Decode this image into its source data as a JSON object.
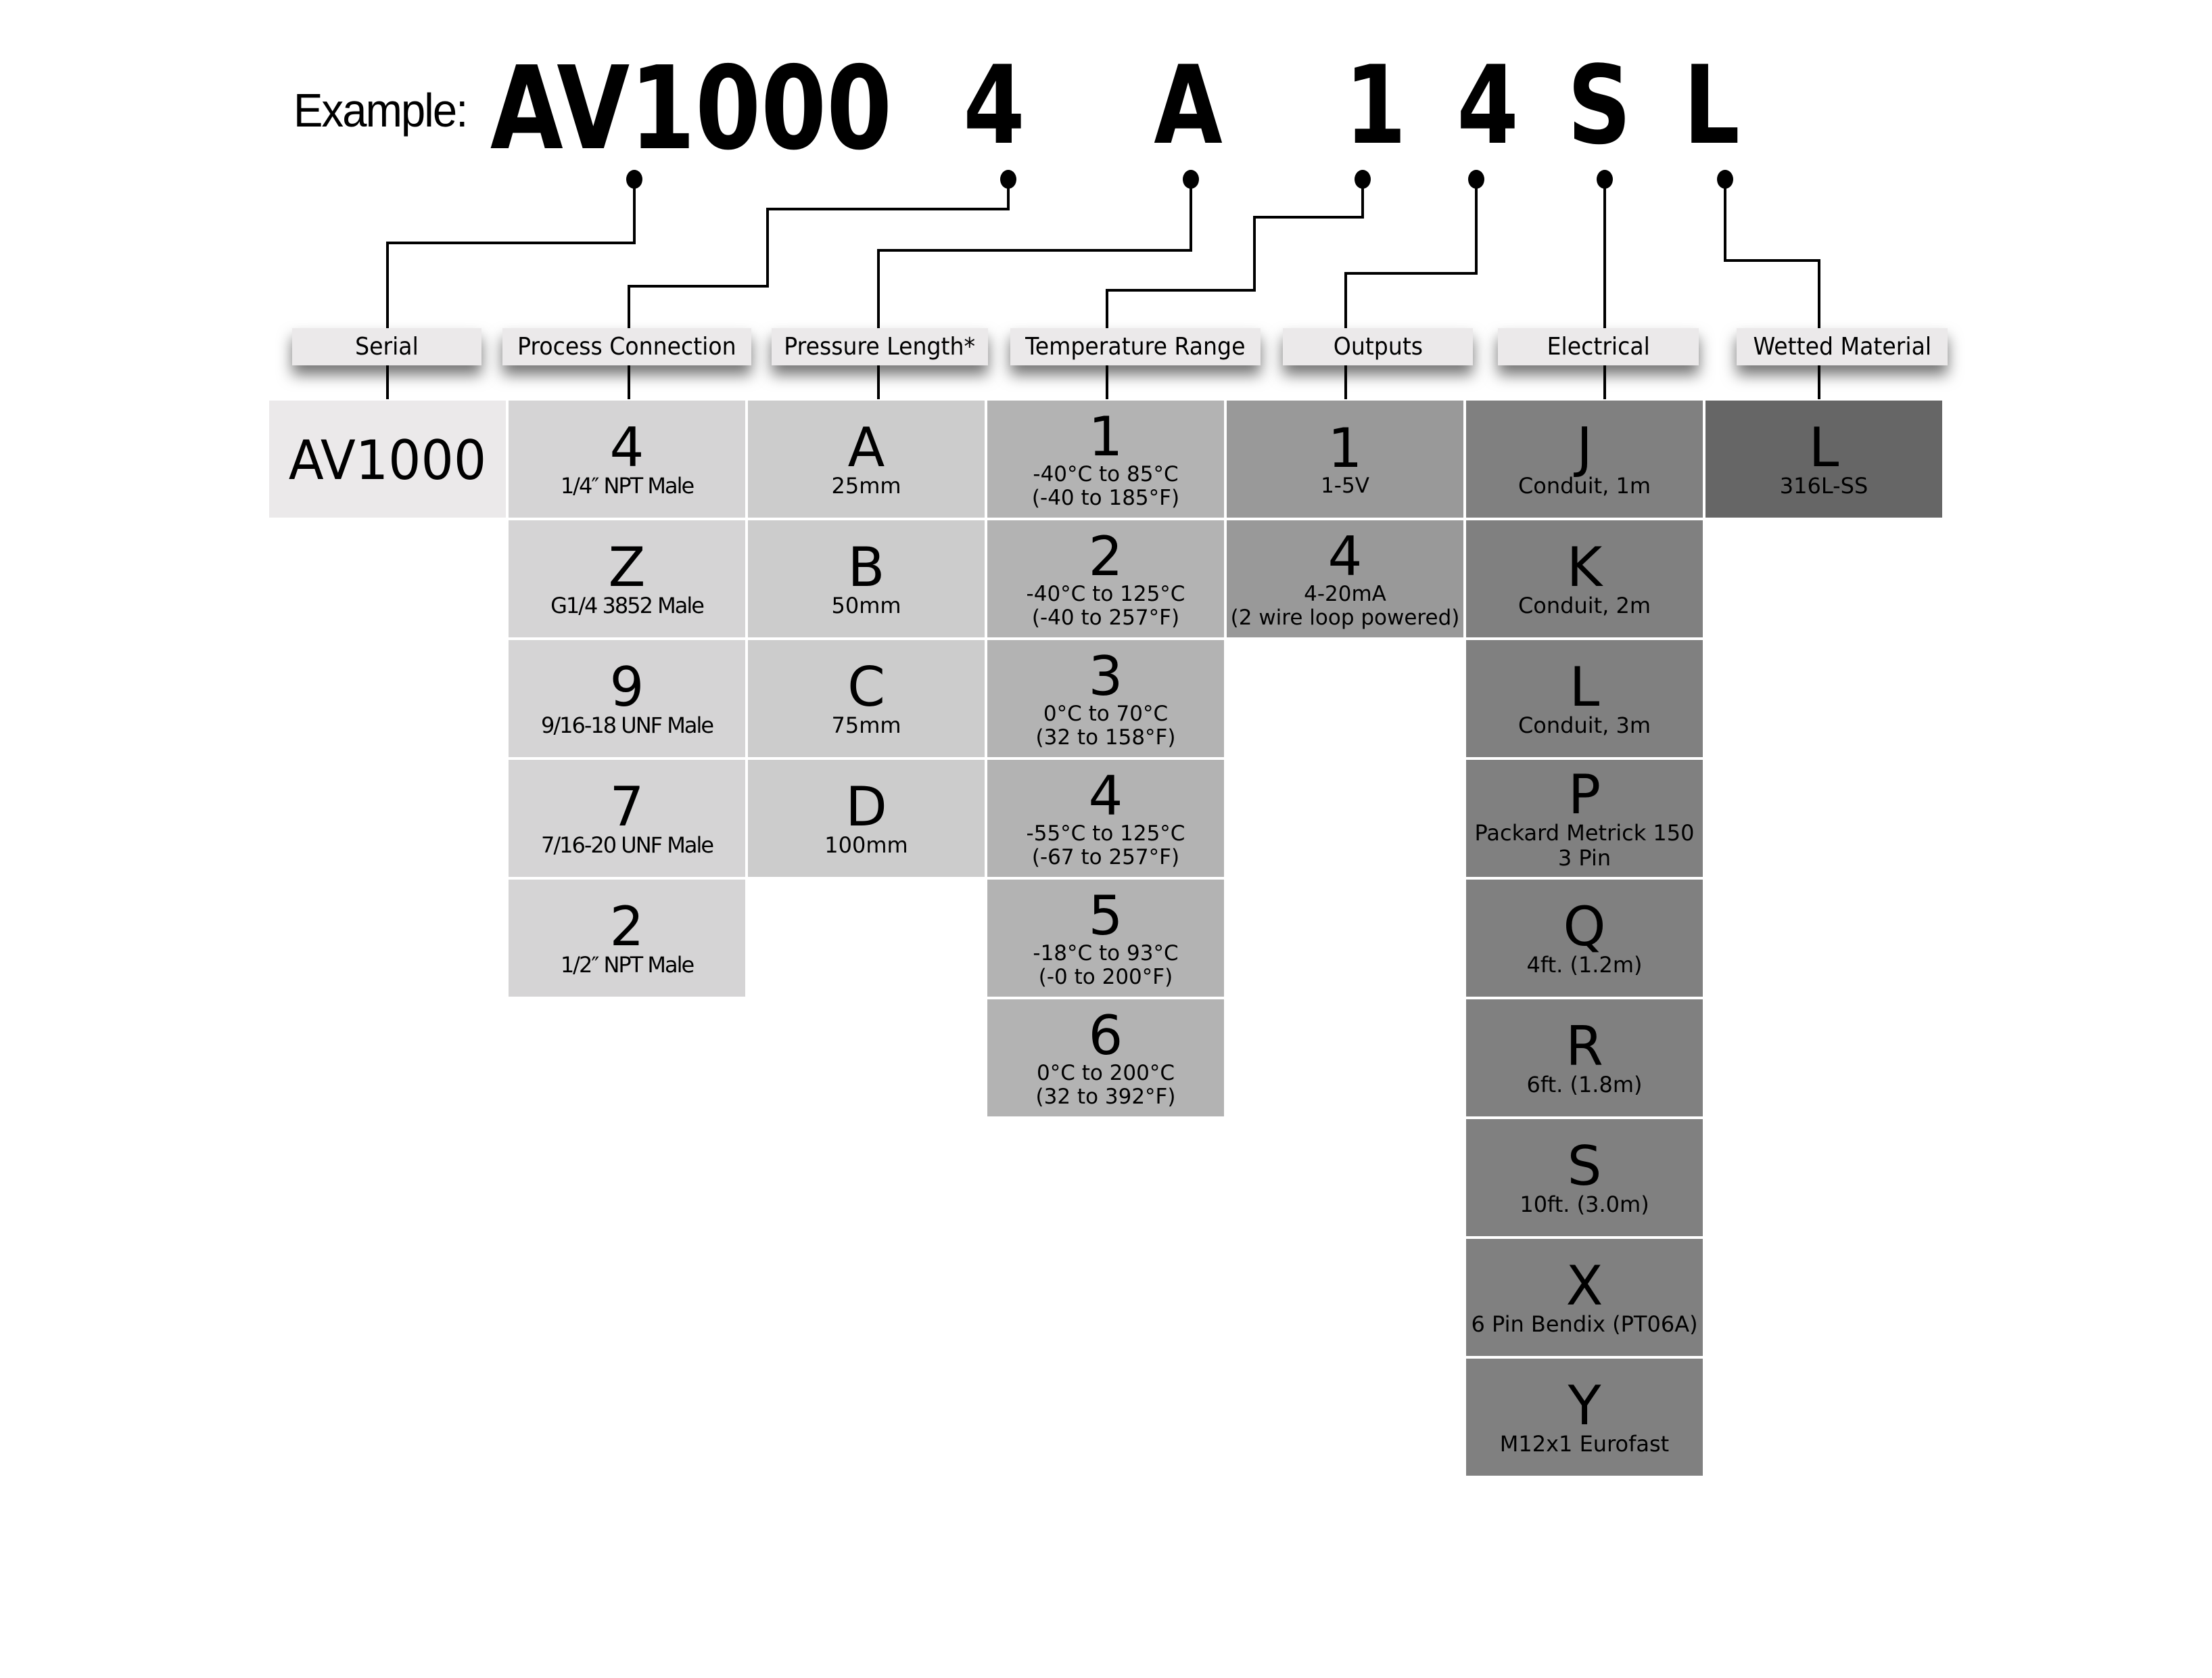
{
  "title": {
    "label": "Example:",
    "code_parts": [
      "AV1000",
      "4",
      "A",
      "1",
      "4",
      "S",
      "L"
    ]
  },
  "colors": {
    "serial": "#ebe9ea",
    "process": "#d5d4d5",
    "pressure": "#cccccc",
    "temperature": "#b3b3b3",
    "outputs": "#999999",
    "electrical": "#808080",
    "wetted": "#666666",
    "connector": "#000000"
  },
  "columns": [
    {
      "key": "serial",
      "header": "Serial",
      "options": [
        {
          "code": "AV1000",
          "desc": ""
        }
      ]
    },
    {
      "key": "process",
      "header": "Process Connection",
      "options": [
        {
          "code": "4",
          "desc": "1/4″  NPT Male"
        },
        {
          "code": "Z",
          "desc": "G1/4 3852 Male"
        },
        {
          "code": "9",
          "desc": "9/16-18 UNF Male"
        },
        {
          "code": "7",
          "desc": "7/16-20 UNF Male"
        },
        {
          "code": "2",
          "desc": "1/2″  NPT Male"
        }
      ]
    },
    {
      "key": "pressure",
      "header": "Pressure Length*",
      "options": [
        {
          "code": "A",
          "desc": "25mm"
        },
        {
          "code": "B",
          "desc": "50mm"
        },
        {
          "code": "C",
          "desc": "75mm"
        },
        {
          "code": "D",
          "desc": "100mm"
        }
      ]
    },
    {
      "key": "temperature",
      "header": "Temperature Range",
      "options": [
        {
          "code": "1",
          "desc": "-40°C to 85°C\n(-40 to 185°F)"
        },
        {
          "code": "2",
          "desc": "-40°C to 125°C\n(-40 to 257°F)"
        },
        {
          "code": "3",
          "desc": "0°C to 70°C\n(32 to 158°F)"
        },
        {
          "code": "4",
          "desc": "-55°C to 125°C\n(-67 to 257°F)"
        },
        {
          "code": "5",
          "desc": "-18°C to 93°C\n(-0 to 200°F)"
        },
        {
          "code": "6",
          "desc": "0°C to 200°C\n(32 to 392°F)"
        }
      ]
    },
    {
      "key": "outputs",
      "header": "Outputs",
      "options": [
        {
          "code": "1",
          "desc": "1-5V"
        },
        {
          "code": "4",
          "desc": "4-20mA\n(2 wire loop powered)"
        }
      ]
    },
    {
      "key": "electrical",
      "header": "Electrical",
      "options": [
        {
          "code": "J",
          "desc": "Conduit, 1m"
        },
        {
          "code": "K",
          "desc": "Conduit, 2m"
        },
        {
          "code": "L",
          "desc": "Conduit, 3m"
        },
        {
          "code": "P",
          "desc": "Packard Metrick 150\n3 Pin"
        },
        {
          "code": "Q",
          "desc": "4ft. (1.2m)"
        },
        {
          "code": "R",
          "desc": "6ft. (1.8m)"
        },
        {
          "code": "S",
          "desc": "10ft. (3.0m)"
        },
        {
          "code": "X",
          "desc": "6 Pin Bendix (PT06A)"
        },
        {
          "code": "Y",
          "desc": "M12x1 Eurofast"
        }
      ]
    },
    {
      "key": "wetted",
      "header": "Wetted Material",
      "options": [
        {
          "code": "L",
          "desc": "316L-SS"
        }
      ]
    }
  ]
}
